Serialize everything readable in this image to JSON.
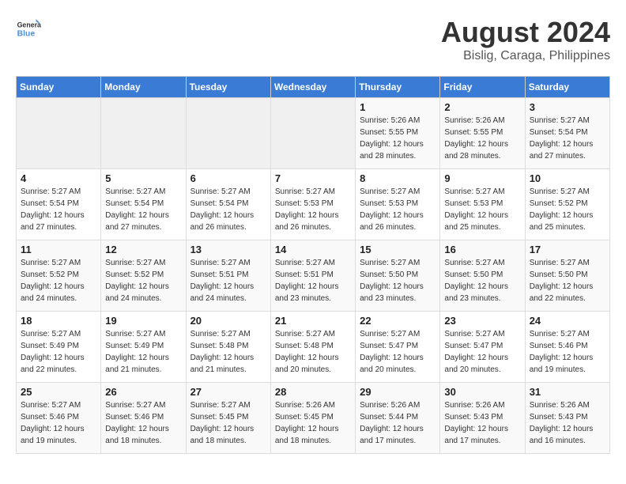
{
  "logo": {
    "line1": "General",
    "line2": "Blue"
  },
  "title": "August 2024",
  "subtitle": "Bislig, Caraga, Philippines",
  "days_of_week": [
    "Sunday",
    "Monday",
    "Tuesday",
    "Wednesday",
    "Thursday",
    "Friday",
    "Saturday"
  ],
  "weeks": [
    [
      {
        "day": "",
        "info": ""
      },
      {
        "day": "",
        "info": ""
      },
      {
        "day": "",
        "info": ""
      },
      {
        "day": "",
        "info": ""
      },
      {
        "day": "1",
        "info": "Sunrise: 5:26 AM\nSunset: 5:55 PM\nDaylight: 12 hours\nand 28 minutes."
      },
      {
        "day": "2",
        "info": "Sunrise: 5:26 AM\nSunset: 5:55 PM\nDaylight: 12 hours\nand 28 minutes."
      },
      {
        "day": "3",
        "info": "Sunrise: 5:27 AM\nSunset: 5:54 PM\nDaylight: 12 hours\nand 27 minutes."
      }
    ],
    [
      {
        "day": "4",
        "info": "Sunrise: 5:27 AM\nSunset: 5:54 PM\nDaylight: 12 hours\nand 27 minutes."
      },
      {
        "day": "5",
        "info": "Sunrise: 5:27 AM\nSunset: 5:54 PM\nDaylight: 12 hours\nand 27 minutes."
      },
      {
        "day": "6",
        "info": "Sunrise: 5:27 AM\nSunset: 5:54 PM\nDaylight: 12 hours\nand 26 minutes."
      },
      {
        "day": "7",
        "info": "Sunrise: 5:27 AM\nSunset: 5:53 PM\nDaylight: 12 hours\nand 26 minutes."
      },
      {
        "day": "8",
        "info": "Sunrise: 5:27 AM\nSunset: 5:53 PM\nDaylight: 12 hours\nand 26 minutes."
      },
      {
        "day": "9",
        "info": "Sunrise: 5:27 AM\nSunset: 5:53 PM\nDaylight: 12 hours\nand 25 minutes."
      },
      {
        "day": "10",
        "info": "Sunrise: 5:27 AM\nSunset: 5:52 PM\nDaylight: 12 hours\nand 25 minutes."
      }
    ],
    [
      {
        "day": "11",
        "info": "Sunrise: 5:27 AM\nSunset: 5:52 PM\nDaylight: 12 hours\nand 24 minutes."
      },
      {
        "day": "12",
        "info": "Sunrise: 5:27 AM\nSunset: 5:52 PM\nDaylight: 12 hours\nand 24 minutes."
      },
      {
        "day": "13",
        "info": "Sunrise: 5:27 AM\nSunset: 5:51 PM\nDaylight: 12 hours\nand 24 minutes."
      },
      {
        "day": "14",
        "info": "Sunrise: 5:27 AM\nSunset: 5:51 PM\nDaylight: 12 hours\nand 23 minutes."
      },
      {
        "day": "15",
        "info": "Sunrise: 5:27 AM\nSunset: 5:50 PM\nDaylight: 12 hours\nand 23 minutes."
      },
      {
        "day": "16",
        "info": "Sunrise: 5:27 AM\nSunset: 5:50 PM\nDaylight: 12 hours\nand 23 minutes."
      },
      {
        "day": "17",
        "info": "Sunrise: 5:27 AM\nSunset: 5:50 PM\nDaylight: 12 hours\nand 22 minutes."
      }
    ],
    [
      {
        "day": "18",
        "info": "Sunrise: 5:27 AM\nSunset: 5:49 PM\nDaylight: 12 hours\nand 22 minutes."
      },
      {
        "day": "19",
        "info": "Sunrise: 5:27 AM\nSunset: 5:49 PM\nDaylight: 12 hours\nand 21 minutes."
      },
      {
        "day": "20",
        "info": "Sunrise: 5:27 AM\nSunset: 5:48 PM\nDaylight: 12 hours\nand 21 minutes."
      },
      {
        "day": "21",
        "info": "Sunrise: 5:27 AM\nSunset: 5:48 PM\nDaylight: 12 hours\nand 20 minutes."
      },
      {
        "day": "22",
        "info": "Sunrise: 5:27 AM\nSunset: 5:47 PM\nDaylight: 12 hours\nand 20 minutes."
      },
      {
        "day": "23",
        "info": "Sunrise: 5:27 AM\nSunset: 5:47 PM\nDaylight: 12 hours\nand 20 minutes."
      },
      {
        "day": "24",
        "info": "Sunrise: 5:27 AM\nSunset: 5:46 PM\nDaylight: 12 hours\nand 19 minutes."
      }
    ],
    [
      {
        "day": "25",
        "info": "Sunrise: 5:27 AM\nSunset: 5:46 PM\nDaylight: 12 hours\nand 19 minutes."
      },
      {
        "day": "26",
        "info": "Sunrise: 5:27 AM\nSunset: 5:46 PM\nDaylight: 12 hours\nand 18 minutes."
      },
      {
        "day": "27",
        "info": "Sunrise: 5:27 AM\nSunset: 5:45 PM\nDaylight: 12 hours\nand 18 minutes."
      },
      {
        "day": "28",
        "info": "Sunrise: 5:26 AM\nSunset: 5:45 PM\nDaylight: 12 hours\nand 18 minutes."
      },
      {
        "day": "29",
        "info": "Sunrise: 5:26 AM\nSunset: 5:44 PM\nDaylight: 12 hours\nand 17 minutes."
      },
      {
        "day": "30",
        "info": "Sunrise: 5:26 AM\nSunset: 5:43 PM\nDaylight: 12 hours\nand 17 minutes."
      },
      {
        "day": "31",
        "info": "Sunrise: 5:26 AM\nSunset: 5:43 PM\nDaylight: 12 hours\nand 16 minutes."
      }
    ]
  ]
}
